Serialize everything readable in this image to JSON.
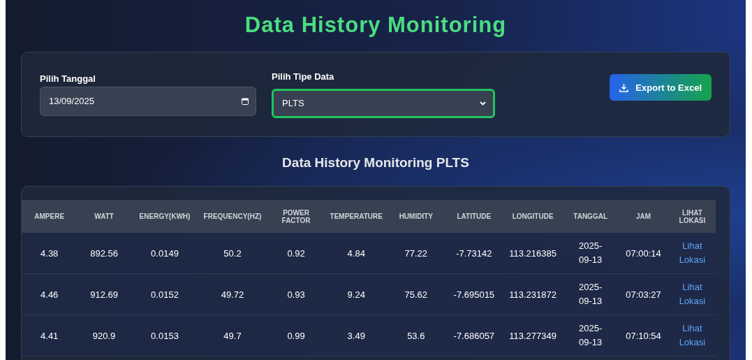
{
  "title": "Data History Monitoring",
  "filters": {
    "date": {
      "label": "Pilih Tanggal",
      "value": "13/09/2025"
    },
    "type": {
      "label": "Pilih Tipe Data",
      "value": "PLTS",
      "focused": true
    },
    "export_button": "Export to Excel"
  },
  "table_title": "Data History Monitoring PLTS",
  "table": {
    "columns": [
      "AMPERE",
      "WATT",
      "ENERGY(KWH)",
      "FREQUENCY(HZ)",
      "POWER FACTOR",
      "TEMPERATURE",
      "HUMIDITY",
      "LATITUDE",
      "LONGITUDE",
      "TANGGAL",
      "JAM",
      "LIHAT LOKASI"
    ],
    "rows": [
      [
        "4.38",
        "892.56",
        "0.0149",
        "50.2",
        "0.92",
        "4.84",
        "77.22",
        "-7.73142",
        "113.216385",
        "2025-09-13",
        "07:00:14",
        "Lihat Lokasi"
      ],
      [
        "4.46",
        "912.69",
        "0.0152",
        "49.72",
        "0.93",
        "9.24",
        "75.62",
        "-7.695015",
        "113.231872",
        "2025-09-13",
        "07:03:27",
        "Lihat Lokasi"
      ],
      [
        "4.41",
        "920.9",
        "0.0153",
        "49.7",
        "0.99",
        "3.49",
        "53.6",
        "-7.686057",
        "113.277349",
        "2025-09-13",
        "07:10:54",
        "Lihat Lokasi"
      ]
    ]
  }
}
